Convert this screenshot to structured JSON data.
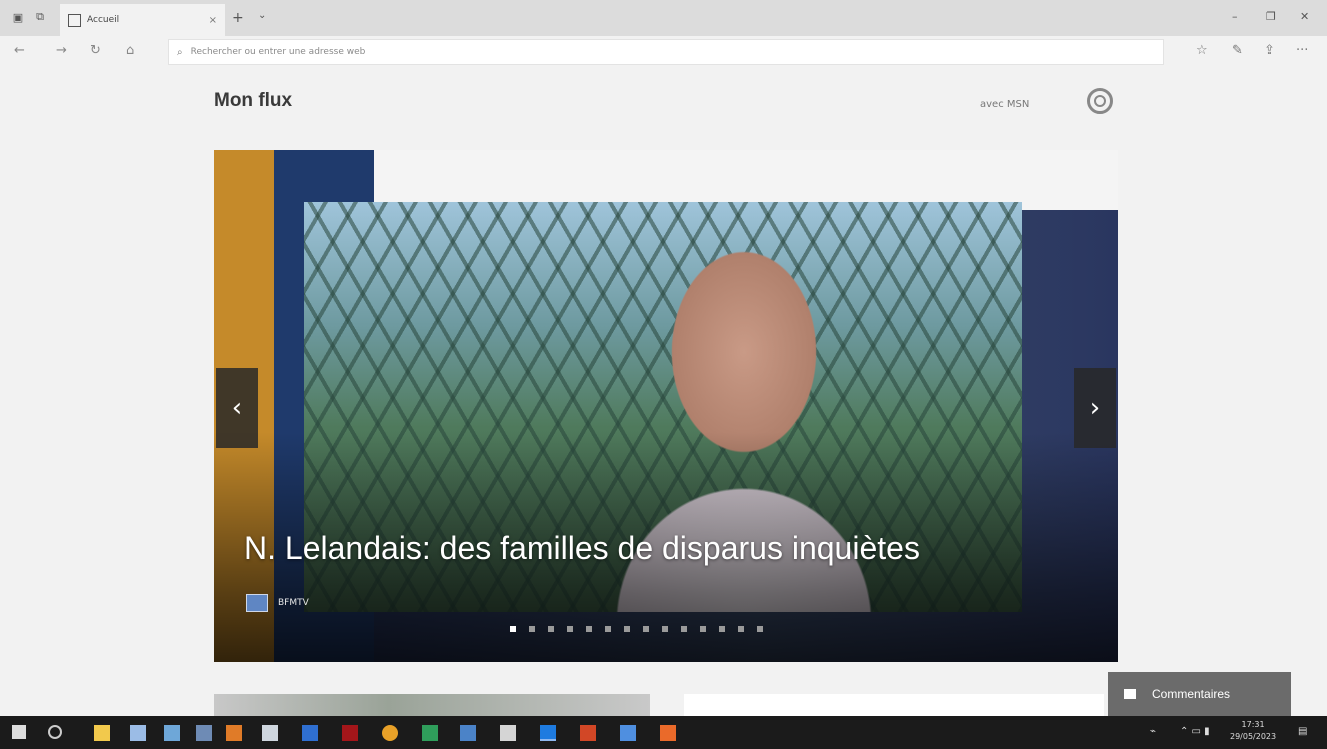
{
  "browser": {
    "tab": {
      "title": "Accueil",
      "close_glyph": "×"
    },
    "new_tab_glyph": "+",
    "tab_menu_glyph": "⌄",
    "window_controls": [
      "–",
      "❐",
      "✕"
    ],
    "nav": {
      "back": "←",
      "forward": "→",
      "refresh": "↻",
      "home": "⌂"
    },
    "address": {
      "placeholder": "Rechercher ou entrer une adresse web",
      "value": ""
    },
    "toolbar": {
      "reading_list": "☆",
      "notes": "✎",
      "share": "⇪",
      "more": "···"
    }
  },
  "page": {
    "title": "Mon flux",
    "powered_by": "avec MSN",
    "settings_icon": "gear-icon"
  },
  "hero": {
    "headline": "N. Lelandais: des familles de disparus inquiètes",
    "source": "BFMTV",
    "prev_glyph": "‹",
    "next_glyph": "›",
    "slide_count": 14,
    "active_slide": 0
  },
  "feedback": {
    "label": "Commentaires",
    "icon": "chat-icon"
  },
  "taskbar": {
    "clock_time": "17:31",
    "clock_date": "29/05/2023"
  },
  "colors": {
    "feedback_bg": "#6b6b6b",
    "taskbar_bg": "#1b1b1b",
    "accent_blue": "#1a73e8"
  }
}
